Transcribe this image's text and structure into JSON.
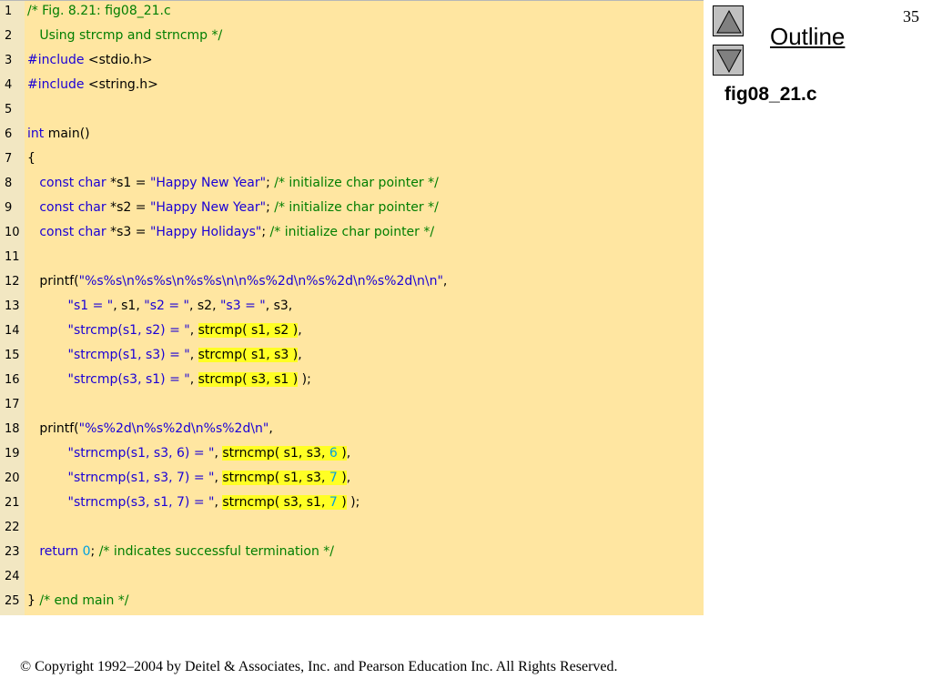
{
  "slide": {
    "page_number": "35",
    "outline_label": "Outline",
    "file_label": "fig08_21.c",
    "copyright": "© Copyright 1992–2004 by Deitel & Associates, Inc. and Pearson Education Inc. All Rights Reserved.",
    "nav": {
      "up_icon": "triangle-up-icon",
      "down_icon": "triangle-down-icon"
    }
  },
  "colors": {
    "code_background": "#ffe6a1",
    "keyword": "#1a00d6",
    "comment": "#007e00",
    "number": "#00a0e0",
    "highlight": "#ffff24"
  },
  "code_lines": [
    {
      "n": "1",
      "segments": [
        {
          "t": "/* Fig. 8.21: fig08_21.c",
          "c": "cmt"
        }
      ]
    },
    {
      "n": "2",
      "segments": [
        {
          "t": "   Using strcmp and strncmp */",
          "c": "cmt"
        }
      ]
    },
    {
      "n": "3",
      "segments": [
        {
          "t": "#include",
          "c": "kw"
        },
        {
          "t": " <stdio.h>"
        }
      ]
    },
    {
      "n": "4",
      "segments": [
        {
          "t": "#include",
          "c": "kw"
        },
        {
          "t": " <string.h>"
        }
      ]
    },
    {
      "n": "5",
      "segments": []
    },
    {
      "n": "6",
      "segments": [
        {
          "t": "int",
          "c": "kw"
        },
        {
          "t": " main()"
        }
      ]
    },
    {
      "n": "7",
      "segments": [
        {
          "t": "{"
        }
      ]
    },
    {
      "n": "8",
      "segments": [
        {
          "t": "   "
        },
        {
          "t": "const",
          "c": "kw"
        },
        {
          "t": " "
        },
        {
          "t": "char",
          "c": "kw"
        },
        {
          "t": " *s1 = "
        },
        {
          "t": "\"Happy New Year\"",
          "c": "str"
        },
        {
          "t": "; "
        },
        {
          "t": "/* initialize char pointer */",
          "c": "cmt"
        }
      ]
    },
    {
      "n": "9",
      "segments": [
        {
          "t": "   "
        },
        {
          "t": "const",
          "c": "kw"
        },
        {
          "t": " "
        },
        {
          "t": "char",
          "c": "kw"
        },
        {
          "t": " *s2 = "
        },
        {
          "t": "\"Happy New Year\"",
          "c": "str"
        },
        {
          "t": "; "
        },
        {
          "t": "/* initialize char pointer */",
          "c": "cmt"
        }
      ]
    },
    {
      "n": "10",
      "segments": [
        {
          "t": "   "
        },
        {
          "t": "const",
          "c": "kw"
        },
        {
          "t": " "
        },
        {
          "t": "char",
          "c": "kw"
        },
        {
          "t": " *s3 = "
        },
        {
          "t": "\"Happy Holidays\"",
          "c": "str"
        },
        {
          "t": "; "
        },
        {
          "t": "/* initialize char pointer */",
          "c": "cmt"
        }
      ]
    },
    {
      "n": "11",
      "segments": []
    },
    {
      "n": "12",
      "segments": [
        {
          "t": "   printf("
        },
        {
          "t": "\"%s%s\\n%s%s\\n%s%s\\n\\n%s%2d\\n%s%2d\\n%s%2d\\n\\n\"",
          "c": "str"
        },
        {
          "t": ","
        }
      ]
    },
    {
      "n": "13",
      "segments": [
        {
          "t": "          "
        },
        {
          "t": "\"s1 = \"",
          "c": "str"
        },
        {
          "t": ", s1, "
        },
        {
          "t": "\"s2 = \"",
          "c": "str"
        },
        {
          "t": ", s2, "
        },
        {
          "t": "\"s3 = \"",
          "c": "str"
        },
        {
          "t": ", s3,"
        }
      ]
    },
    {
      "n": "14",
      "segments": [
        {
          "t": "          "
        },
        {
          "t": "\"strcmp(s1, s2) = \"",
          "c": "str"
        },
        {
          "t": ", "
        },
        {
          "t": "strcmp( s1, s2 )",
          "c": "hl"
        },
        {
          "t": ","
        }
      ]
    },
    {
      "n": "15",
      "segments": [
        {
          "t": "          "
        },
        {
          "t": "\"strcmp(s1, s3) = \"",
          "c": "str"
        },
        {
          "t": ", "
        },
        {
          "t": "strcmp( s1, s3 )",
          "c": "hl"
        },
        {
          "t": ","
        }
      ]
    },
    {
      "n": "16",
      "segments": [
        {
          "t": "          "
        },
        {
          "t": "\"strcmp(s3, s1) = \"",
          "c": "str"
        },
        {
          "t": ", "
        },
        {
          "t": "strcmp( s3, s1 )",
          "c": "hl"
        },
        {
          "t": " );"
        }
      ]
    },
    {
      "n": "17",
      "segments": []
    },
    {
      "n": "18",
      "segments": [
        {
          "t": "   printf("
        },
        {
          "t": "\"%s%2d\\n%s%2d\\n%s%2d\\n\"",
          "c": "str"
        },
        {
          "t": ","
        }
      ]
    },
    {
      "n": "19",
      "segments": [
        {
          "t": "          "
        },
        {
          "t": "\"strncmp(s1, s3, 6) = \"",
          "c": "str"
        },
        {
          "t": ", "
        },
        {
          "t": "strncmp( s1, s3, ",
          "c": "hl"
        },
        {
          "t": "6",
          "c": "hl num"
        },
        {
          "t": " )",
          "c": "hl"
        },
        {
          "t": ","
        }
      ]
    },
    {
      "n": "20",
      "segments": [
        {
          "t": "          "
        },
        {
          "t": "\"strncmp(s1, s3, 7) = \"",
          "c": "str"
        },
        {
          "t": ", "
        },
        {
          "t": "strncmp( s1, s3, ",
          "c": "hl"
        },
        {
          "t": "7",
          "c": "hl num"
        },
        {
          "t": " )",
          "c": "hl"
        },
        {
          "t": ","
        }
      ]
    },
    {
      "n": "21",
      "segments": [
        {
          "t": "          "
        },
        {
          "t": "\"strncmp(s3, s1, 7) = \"",
          "c": "str"
        },
        {
          "t": ", "
        },
        {
          "t": "strncmp( s3, s1, ",
          "c": "hl"
        },
        {
          "t": "7",
          "c": "hl num"
        },
        {
          "t": " )",
          "c": "hl"
        },
        {
          "t": " );"
        }
      ]
    },
    {
      "n": "22",
      "segments": []
    },
    {
      "n": "23",
      "segments": [
        {
          "t": "   "
        },
        {
          "t": "return",
          "c": "kw"
        },
        {
          "t": " "
        },
        {
          "t": "0",
          "c": "num"
        },
        {
          "t": "; "
        },
        {
          "t": "/* indicates successful termination */",
          "c": "cmt"
        }
      ]
    },
    {
      "n": "24",
      "segments": []
    },
    {
      "n": "25",
      "segments": [
        {
          "t": "} "
        },
        {
          "t": "/* end main */",
          "c": "cmt"
        }
      ]
    }
  ]
}
